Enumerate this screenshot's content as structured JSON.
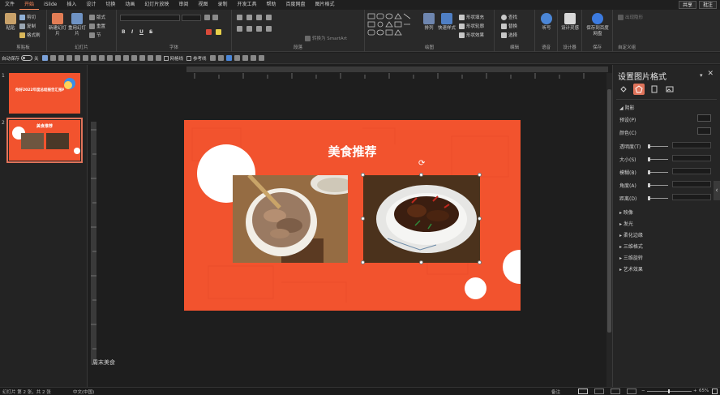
{
  "menu": {
    "tabs": [
      "文件",
      "开始",
      "iSlide",
      "插入",
      "设计",
      "切换",
      "动画",
      "幻灯片放映",
      "审阅",
      "视图",
      "录制",
      "开发工具",
      "帮助",
      "百度网盘",
      "图片格式"
    ],
    "active": "开始",
    "share_label": "共享",
    "comment_label": "批注"
  },
  "ribbon": {
    "clipboard": {
      "paste": "粘贴",
      "cut": "剪切",
      "copy": "复制",
      "format_painter": "格式刷",
      "label": "剪贴板"
    },
    "slides": {
      "new_slide": "新建幻灯片",
      "reuse": "重用幻灯片",
      "layout": "版式",
      "reset": "重置",
      "section": "节",
      "label": "幻灯片"
    },
    "font": {
      "bold": "B",
      "italic": "I",
      "underline": "U",
      "strike": "S",
      "label": "字体"
    },
    "paragraph": {
      "smartart": "转换为 SmartArt",
      "label": "段落"
    },
    "drawing": {
      "arrange": "排列",
      "quick_styles": "快速样式",
      "fill": "形状填充",
      "outline": "形状轮廓",
      "effects": "形状效果",
      "label": "绘图"
    },
    "editing": {
      "find": "查找",
      "replace": "替换",
      "select": "选择",
      "label": "编辑"
    },
    "voice": {
      "dictate": "听写",
      "label": "语音"
    },
    "designer": {
      "design_ideas": "设计灵感",
      "label": "设计器"
    },
    "save": {
      "baidu": "保存到百度网盘",
      "label": "保存"
    },
    "hidden_group": {
      "item": "出现隐形",
      "label": "自定义组"
    }
  },
  "qat": {
    "autosave_label": "自动保存",
    "autosave_state": "关",
    "gridlines": "网格线",
    "guides": "参考线"
  },
  "thumbnails": [
    {
      "number": "1",
      "caption": "你好2022年度总结报告汇报PPT"
    },
    {
      "number": "2",
      "caption": "美食推荐"
    }
  ],
  "slide": {
    "title": "美食推荐",
    "notes": "周末美食"
  },
  "format_pane": {
    "title": "设置图片格式",
    "section_shadow": "阴影",
    "rows": [
      {
        "label": "预设(P)",
        "type": "swatch"
      },
      {
        "label": "颜色(C)",
        "type": "swatch"
      },
      {
        "label": "透明度(T)",
        "type": "slider"
      },
      {
        "label": "大小(S)",
        "type": "slider"
      },
      {
        "label": "模糊(B)",
        "type": "slider"
      },
      {
        "label": "角度(A)",
        "type": "slider"
      },
      {
        "label": "距离(D)",
        "type": "slider"
      }
    ],
    "collapsed_sections": [
      "映像",
      "发光",
      "柔化边缘",
      "三维格式",
      "三维旋转",
      "艺术效果"
    ]
  },
  "status": {
    "slide_info": "幻灯片 第 2 张，共 2 张",
    "language": "中文(中国)",
    "notes_label": "备注",
    "zoom": "65%"
  }
}
